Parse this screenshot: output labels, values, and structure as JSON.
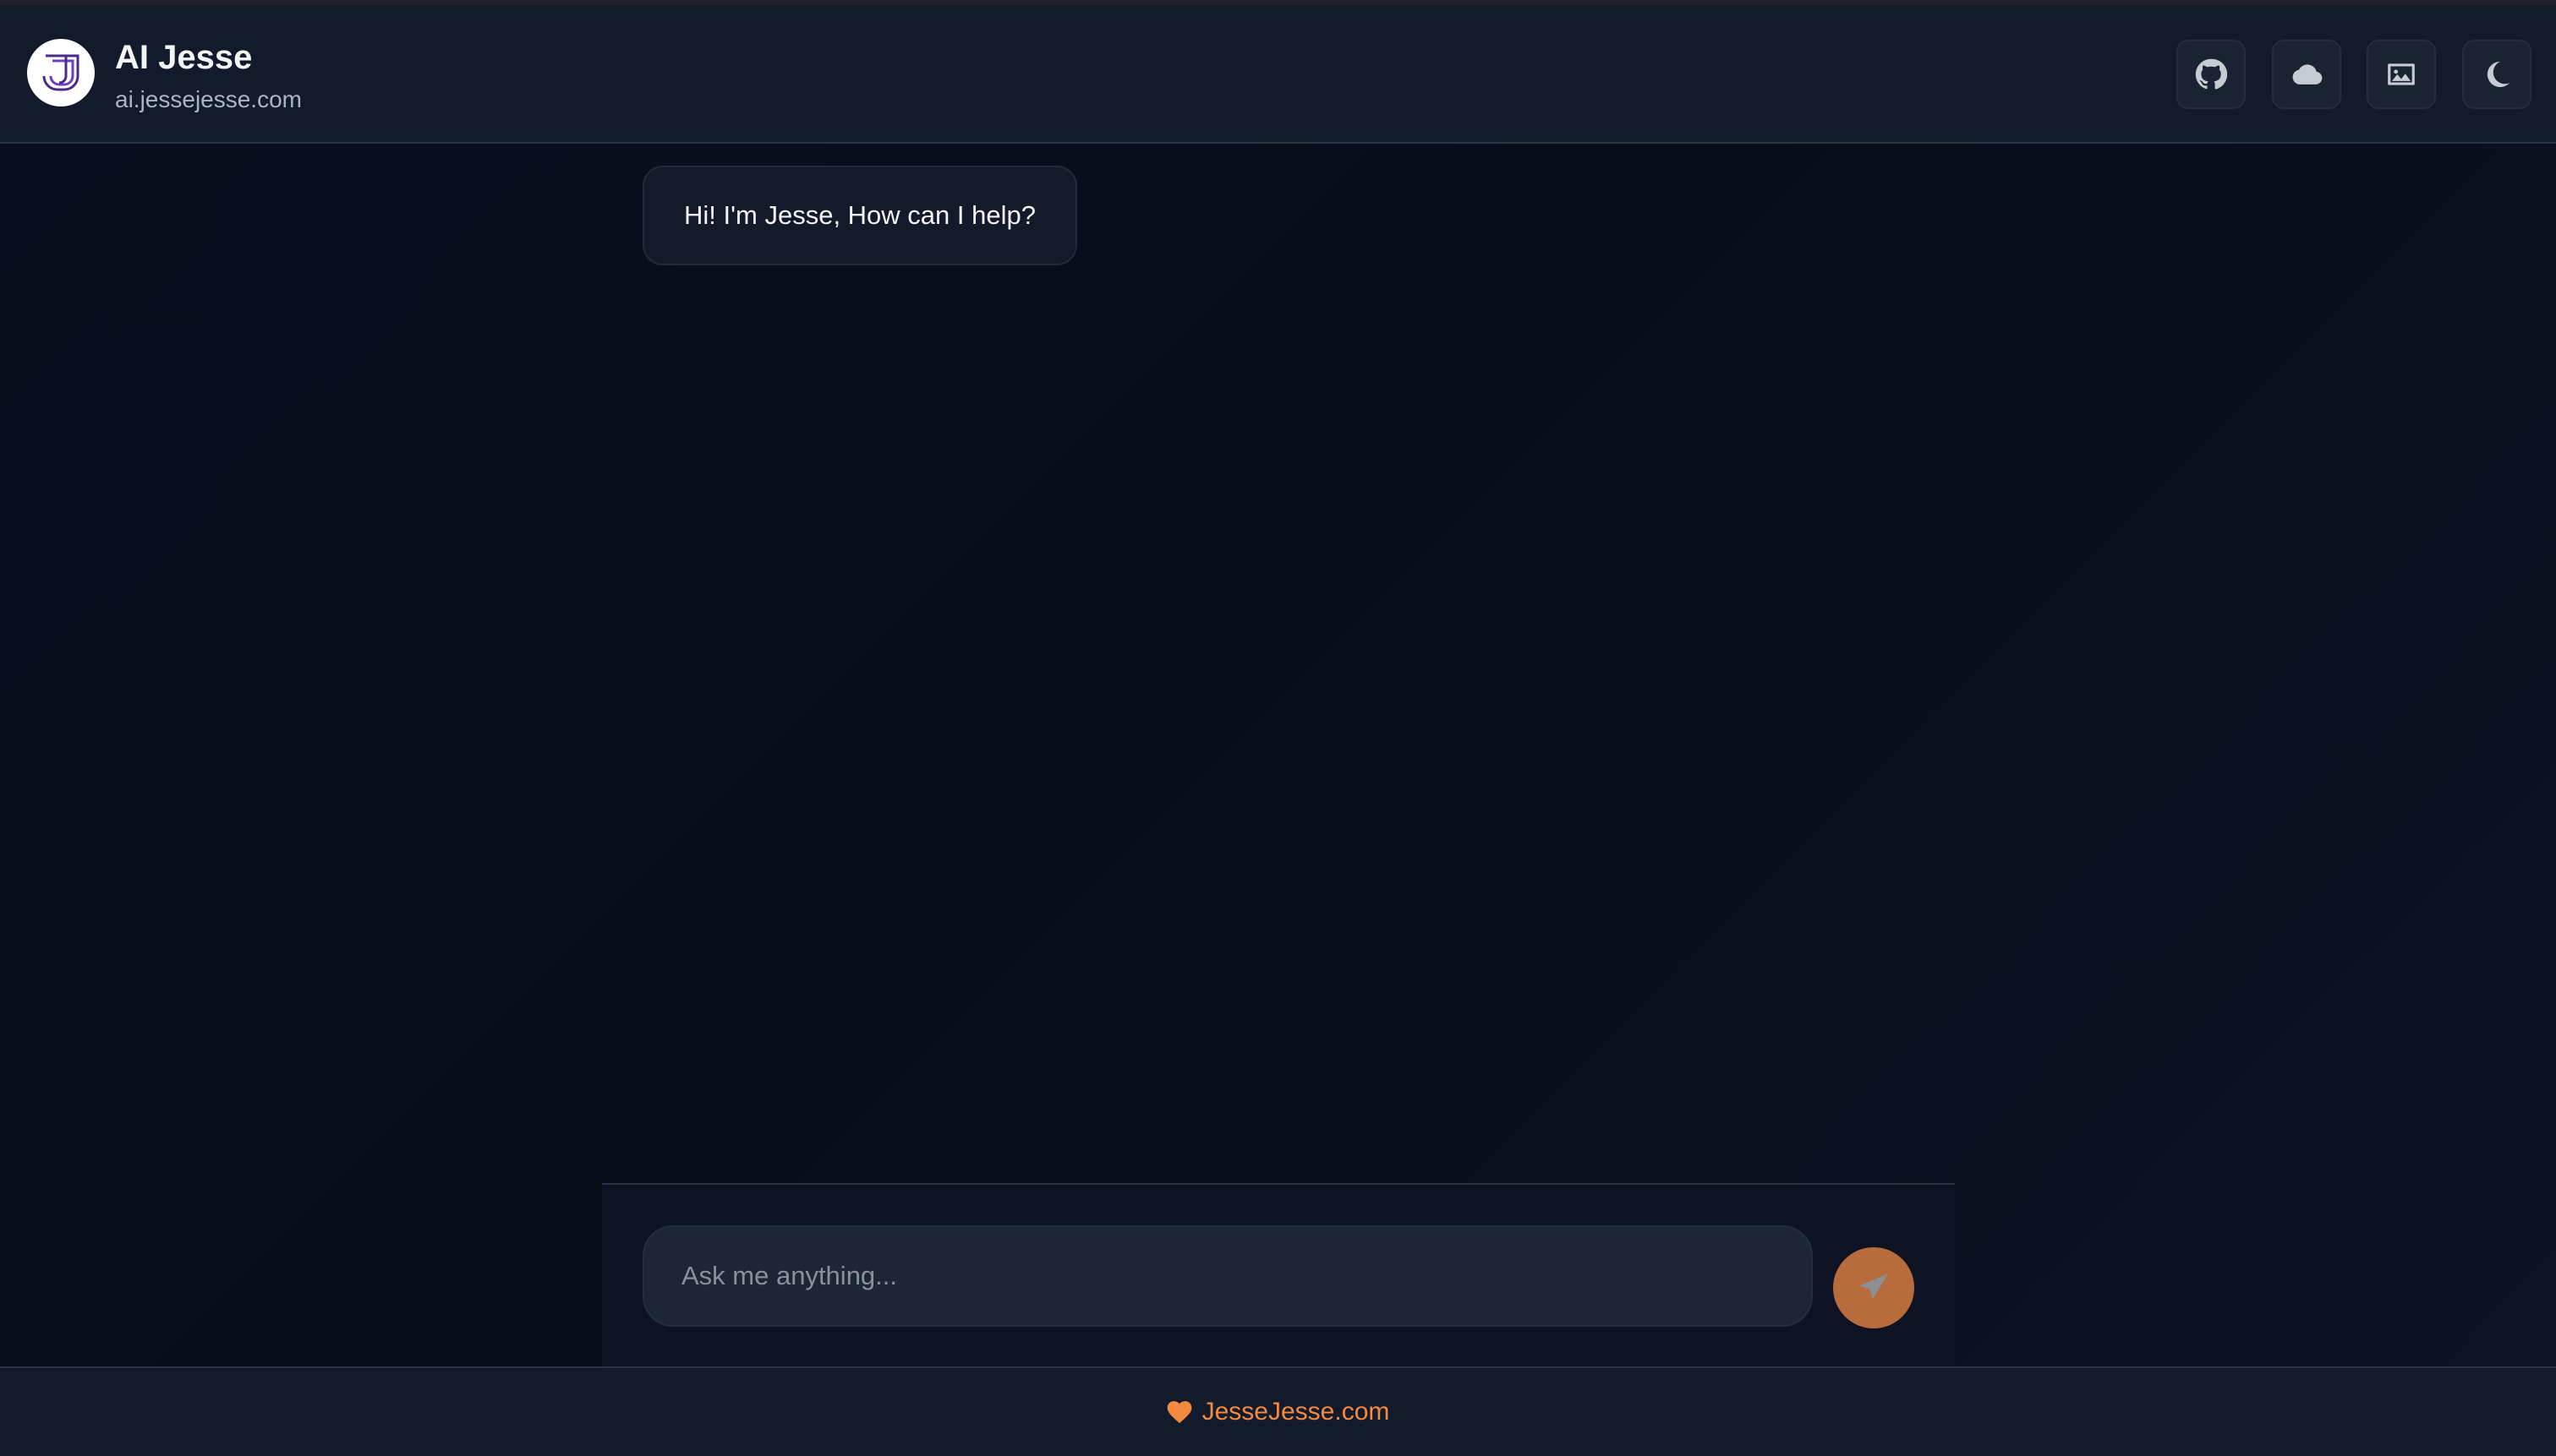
{
  "header": {
    "title": "AI Jesse",
    "subtitle": "ai.jessejesse.com",
    "actions": [
      {
        "icon": "github-icon"
      },
      {
        "icon": "cloud-icon"
      },
      {
        "icon": "image-icon"
      },
      {
        "icon": "moon-icon"
      }
    ]
  },
  "chat": {
    "messages": [
      {
        "role": "assistant",
        "text": "Hi! I'm Jesse, How can I help?"
      }
    ]
  },
  "composer": {
    "placeholder": "Ask me anything...",
    "value": "",
    "send_icon": "paper-plane-icon"
  },
  "footer": {
    "icon": "heart-icon",
    "link_text": "JesseJesse.com"
  },
  "colors": {
    "accent": "#f28a3f",
    "send_button": "#b86b3b",
    "background": "#0a0f1f",
    "header": "#121a2b"
  }
}
